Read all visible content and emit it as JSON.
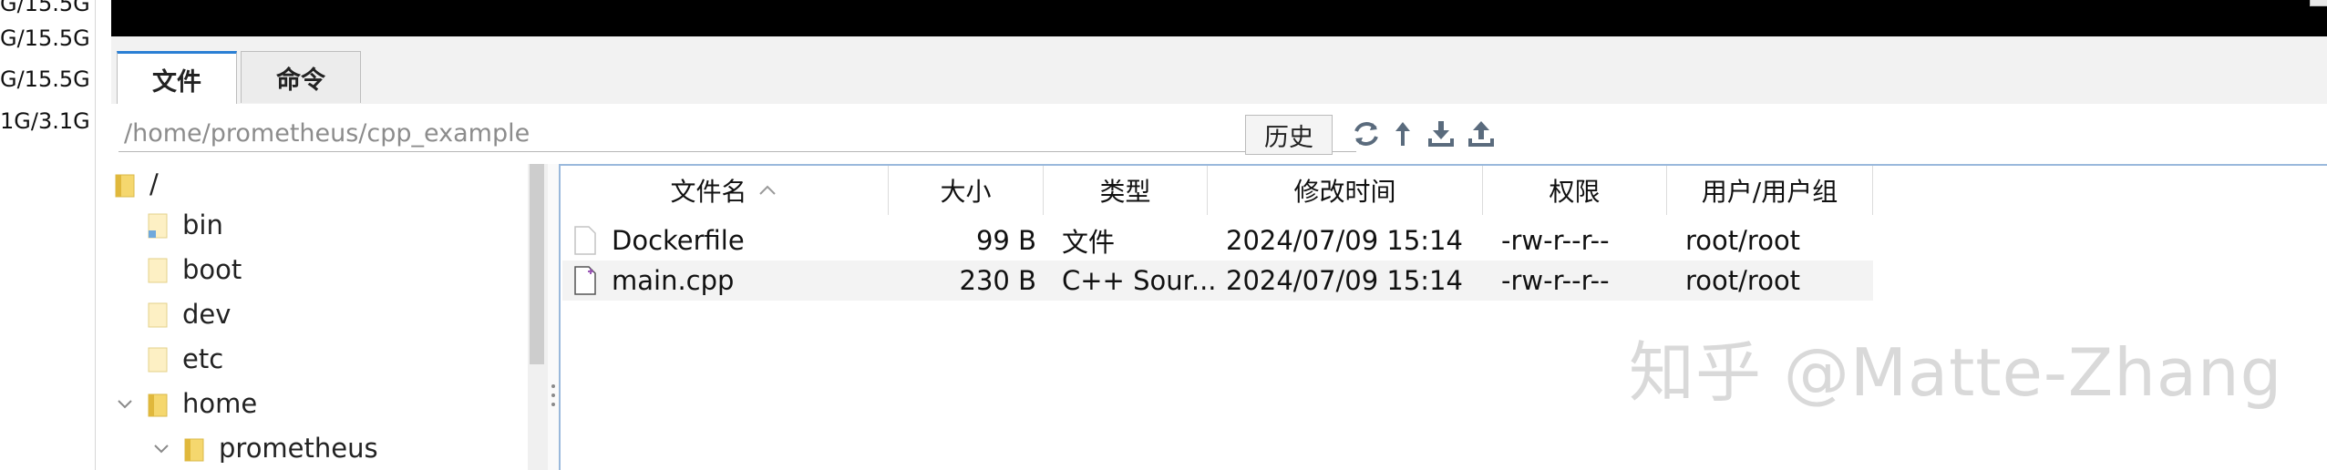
{
  "sidebar": {
    "memory_lines": [
      "G/15.5G",
      "G/15.5G",
      "G/15.5G",
      "1G/3.1G"
    ]
  },
  "tabs": [
    {
      "label": "文件",
      "active": true
    },
    {
      "label": "命令",
      "active": false
    }
  ],
  "pathbar": {
    "path": "/home/prometheus/cpp_example",
    "history_label": "历史",
    "icons": [
      "refresh-icon",
      "go-up-icon",
      "download-icon",
      "upload-icon"
    ]
  },
  "tree": {
    "root": "/",
    "items": [
      {
        "label": "bin",
        "icon": "folder-link-icon"
      },
      {
        "label": "boot",
        "icon": "folder-icon"
      },
      {
        "label": "dev",
        "icon": "folder-icon"
      },
      {
        "label": "etc",
        "icon": "folder-icon"
      },
      {
        "label": "home",
        "icon": "folder-icon",
        "expanded": true
      },
      {
        "label": "prometheus",
        "icon": "folder-icon",
        "expanded": true
      }
    ]
  },
  "file_table": {
    "columns": [
      "文件名",
      "大小",
      "类型",
      "修改时间",
      "权限",
      "用户/用户组"
    ],
    "sort_column": "文件名",
    "rows": [
      {
        "name": "Dockerfile",
        "size": "99 B",
        "type": "文件",
        "modified": "2024/07/09 15:14",
        "perms": "-rw-r--r--",
        "owner": "root/root",
        "icon": "file-icon"
      },
      {
        "name": "main.cpp",
        "size": "230 B",
        "type": "C++ Sour...",
        "modified": "2024/07/09 15:14",
        "perms": "-rw-r--r--",
        "owner": "root/root",
        "icon": "cpp-file-icon"
      }
    ]
  },
  "watermark": "知乎 @Matte-Zhang",
  "colors": {
    "accent": "#2a7fd4",
    "folder": "#f5d76e",
    "panel_border": "#9ab9dc"
  }
}
